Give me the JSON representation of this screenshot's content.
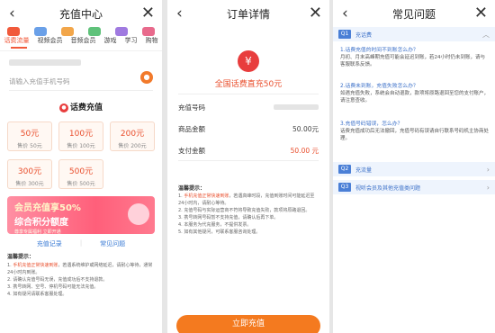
{
  "colors": {
    "accent": "#f15a3b",
    "button": "#f47a1f",
    "price_red": "#e94e2c",
    "faq_blue": "#4a7fd6"
  },
  "panel1": {
    "title": "充值中心",
    "back_icon": "chevron-left-icon",
    "close_icon": "close-icon",
    "categories": [
      {
        "label": "话费流量",
        "color": "#f15a3b"
      },
      {
        "label": "视频会员",
        "color": "#6aa0e8"
      },
      {
        "label": "音频会员",
        "color": "#f2a64a"
      },
      {
        "label": "游戏",
        "color": "#5fc27a"
      },
      {
        "label": "学习",
        "color": "#a07ae0"
      },
      {
        "label": "购物",
        "color": "#e86a8c"
      }
    ],
    "phone_placeholder": "请输入充值手机号码",
    "section_title": "话费充值",
    "cards": [
      {
        "face": "50元",
        "price": "售价 50元"
      },
      {
        "face": "100元",
        "price": "售价 100元"
      },
      {
        "face": "200元",
        "price": "售价 200元"
      },
      {
        "face": "300元",
        "price": "售价 300元"
      },
      {
        "face": "500元",
        "price": "售价 500元"
      }
    ],
    "banner": {
      "line1": "会员充值享50%",
      "line2": "综合积分额度",
      "line3": "尊享专属福利 立即开通"
    },
    "links": {
      "left": "充值记录",
      "right": "常见问题"
    },
    "tips_title": "温馨提示：",
    "tips": [
      {
        "prefix": "1. ",
        "red": "手机充值正常快速到账",
        "text": "，若遇系统维护或网络延迟，请耐心等待，通常24小时内到账。"
      },
      {
        "prefix": "2. ",
        "red": "",
        "text": "请确认充值号码无误，充值成功后不支持退款。"
      },
      {
        "prefix": "3. ",
        "red": "",
        "text": "携号转网、空号、停机号码可能无法充值。"
      },
      {
        "prefix": "4. ",
        "red": "",
        "text": "如有疑问请联系客服处理。"
      }
    ]
  },
  "panel2": {
    "title": "订单详情",
    "back_icon": "chevron-left-icon",
    "close_icon": "close-icon",
    "order_icon": "yuan-icon",
    "order_title": "全国话费直充50元",
    "rows": [
      {
        "label": "充值号码",
        "value": "",
        "style": "blur"
      },
      {
        "label": "商品金额",
        "value": "50.00元",
        "style": "normal"
      },
      {
        "label": "支付金额",
        "value": "50.00 元",
        "style": "red"
      }
    ],
    "notice_title": "温馨提示：",
    "notice": [
      {
        "prefix": "1. ",
        "red": "手机充值正常快速到账",
        "text": "，若遇高峰时段，充值到账时间可能延迟至24小时内，请耐心等待。"
      },
      {
        "prefix": "2. ",
        "red": "",
        "text": "充值号码与实际运营商不符将导致充值失败，款项将原路退回。"
      },
      {
        "prefix": "3. ",
        "red": "",
        "text": "携号转网号码暂不支持充值，请确认后再下单。"
      },
      {
        "prefix": "4. ",
        "red": "",
        "text": "本服务为代充服务，不提供发票。"
      },
      {
        "prefix": "5. ",
        "red": "",
        "text": "如有其他疑问，可联系客服咨询处理。"
      }
    ],
    "pay_button": "立即充值"
  },
  "panel3": {
    "title": "常见问题",
    "back_icon": "chevron-left-icon",
    "close_icon": "close-icon",
    "faq1": {
      "tag": "Q1",
      "title": "充话费"
    },
    "qa": [
      {
        "q": "1.话费充值的时间不到账怎么办？",
        "a": "月初、月末高峰期充值可能会延迟到账，若24小时仍未到账，请与客服联系反馈。"
      },
      {
        "q": "2.话费未到账，充值失败怎么办？",
        "a": "如遇充值失败，系统会自动退款，款项将原路退回至您的支付账户，请注意查收。"
      },
      {
        "q": "3.充值号码错误，怎么办？",
        "a": "话费充值成功后无法撤回，充值号码有误请自行联系号码机主协商处理。"
      }
    ],
    "faq2": {
      "tag": "Q2",
      "title": "充流量"
    },
    "faq3": {
      "tag": "Q3",
      "title": "视听会员及其他充值类问题"
    }
  }
}
